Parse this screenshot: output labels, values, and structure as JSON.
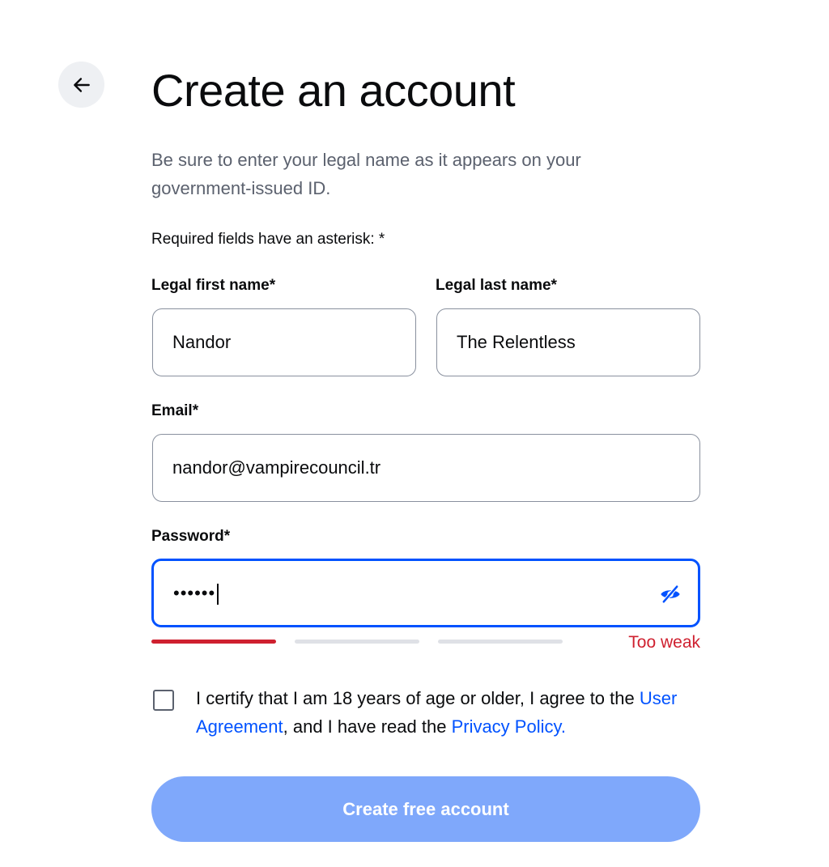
{
  "header": {
    "title": "Create an account",
    "subtitle": "Be sure to enter your legal name as it appears on your government-issued ID.",
    "required_note": "Required fields have an asterisk: *"
  },
  "form": {
    "first_name": {
      "label": "Legal first name*",
      "value": "Nandor"
    },
    "last_name": {
      "label": "Legal last name*",
      "value": "The Relentless"
    },
    "email": {
      "label": "Email*",
      "value": "nandor@vampirecouncil.tr"
    },
    "password": {
      "label": "Password*",
      "masked_value": "••••••",
      "strength_label": "Too weak",
      "strength_level": 1,
      "strength_segments": 3
    },
    "consent": {
      "text_before": "I certify that I am 18 years of age or older, I agree to the ",
      "user_agreement_link": "User Agreement",
      "text_middle": ", and I have read the ",
      "privacy_link": "Privacy Policy.",
      "checked": false
    },
    "submit_label": "Create free account"
  },
  "icons": {
    "back": "arrow-left-icon",
    "password_toggle": "eye-slash-icon"
  },
  "colors": {
    "accent": "#0052ff",
    "button_disabled": "#7fa8fb",
    "error": "#cf202f",
    "muted_text": "#5b616e"
  }
}
